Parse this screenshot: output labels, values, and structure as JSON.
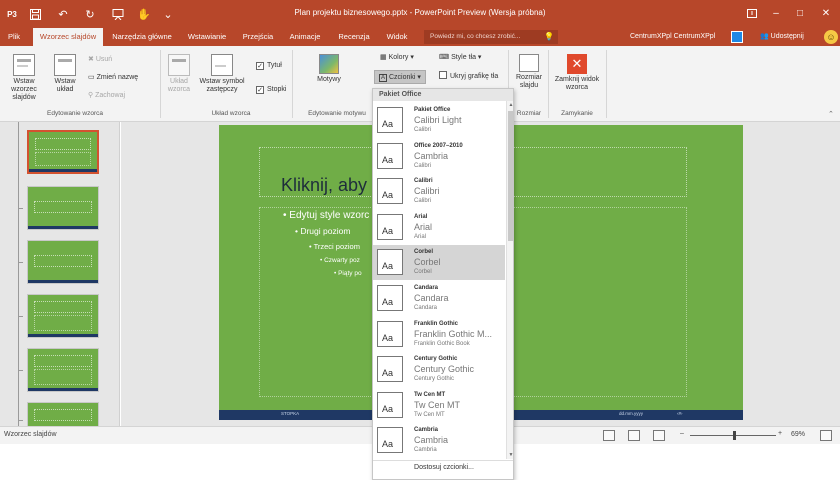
{
  "titlebar": {
    "app_icon": "P3",
    "title": "Plan projektu biznesowego.pptx - PowerPoint Preview (Wersja próbna)",
    "qa_icons": [
      "save-icon",
      "undo-icon",
      "redo-icon",
      "slideshow-icon",
      "touch-icon",
      "more-icon"
    ],
    "window_icons": [
      "ribbon-display-icon",
      "minimize-icon",
      "maximize-icon",
      "close-icon"
    ]
  },
  "tabs": [
    "Plik",
    "Wzorzec slajdów",
    "Narzędzia główne",
    "Wstawianie",
    "Przejścia",
    "Animacje",
    "Recenzja",
    "Widok"
  ],
  "search": {
    "placeholder": "Powiedz mi, co chcesz zrobić..."
  },
  "user": {
    "name": "CentrumXPpl CentrumXPpl",
    "share": "Udostępnij"
  },
  "ribbon": {
    "insert_master": "Wstaw wzorzec slajdów",
    "insert_layout": "Wstaw układ",
    "delete": "Usuń",
    "rename": "Zmień nazwę",
    "preserve": "Zachowaj",
    "group_edit_master": "Edytowanie wzorca",
    "layout": "Układ wzorca",
    "insert_placeholder": "Wstaw symbol zastępczy",
    "title_check": "Tytuł",
    "footers_check": "Stopki",
    "group_layout": "Układ wzorca",
    "themes": "Motywy",
    "group_edit_theme": "Edytowanie motywu",
    "colors": "Kolory",
    "fonts": "Czcionki",
    "bg_styles": "Style tła",
    "hide_bg": "Ukryj grafikę tła",
    "slide_size": "Rozmiar slajdu",
    "group_size": "Rozmiar",
    "close_master": "Zamknij widok wzorca",
    "group_close": "Zamykanie"
  },
  "slide": {
    "title": "Kliknij, aby e",
    "levels": [
      "• Edytuj style wzorc",
      "• Drugi poziom",
      "• Trzeci poziom",
      "• Czwarty poz",
      "• Piąty po"
    ],
    "footer": "STOPKA",
    "date": "dd.mm.yyyy",
    "page": "‹#›"
  },
  "fonts_dropdown": {
    "header": "Pakiet Office",
    "sample": "Aa",
    "items": [
      {
        "name": "Pakiet Office",
        "heading": "Calibri Light",
        "body": "Calibri"
      },
      {
        "name": "Office 2007–2010",
        "heading": "Cambria",
        "body": "Calibri"
      },
      {
        "name": "Calibri",
        "heading": "Calibri",
        "body": "Calibri"
      },
      {
        "name": "Arial",
        "heading": "Arial",
        "body": "Arial"
      },
      {
        "name": "Corbel",
        "heading": "Corbel",
        "body": "Corbel"
      },
      {
        "name": "Candara",
        "heading": "Candara",
        "body": "Candara"
      },
      {
        "name": "Franklin Gothic",
        "heading": "Franklin Gothic M...",
        "body": "Franklin Gothic Book"
      },
      {
        "name": "Century Gothic",
        "heading": "Century Gothic",
        "body": "Century Gothic"
      },
      {
        "name": "Tw Cen MT",
        "heading": "Tw Cen MT",
        "body": "Tw Cen MT"
      },
      {
        "name": "Cambria",
        "heading": "Cambria",
        "body": "Cambria"
      }
    ],
    "customize": "Dostosuj czcionki..."
  },
  "statusbar": {
    "view": "Wzorzec slajdów",
    "zoom": "69%"
  },
  "colors": {
    "accent": "#b7472a",
    "slide": "#70ad47",
    "slide_footer": "#1f3864"
  }
}
